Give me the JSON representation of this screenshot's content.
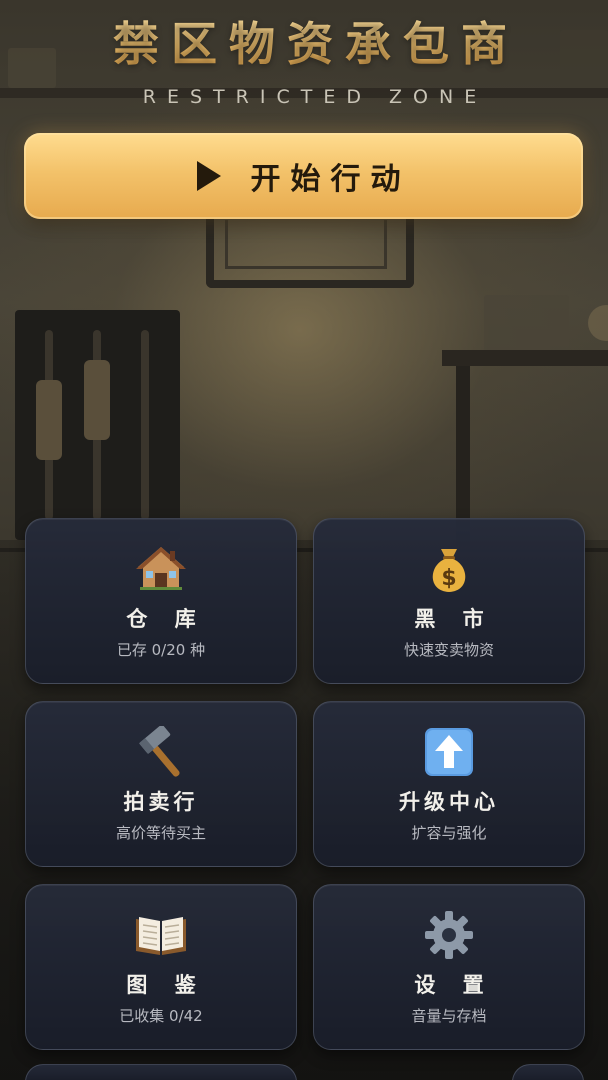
{
  "header": {
    "title": "禁区物资承包商",
    "subtitle": "RESTRICTED ZONE"
  },
  "start_button": {
    "label": "开始行动",
    "icon": "play-icon"
  },
  "menu": [
    {
      "key": "warehouse",
      "icon": "house-icon",
      "label": "仓 库",
      "sub": "已存 0/20 种"
    },
    {
      "key": "black-market",
      "icon": "money-bag-icon",
      "label": "黑 市",
      "sub": "快速变卖物资"
    },
    {
      "key": "auction",
      "icon": "hammer-icon",
      "label": "拍卖行",
      "sub": "高价等待买主"
    },
    {
      "key": "upgrade",
      "icon": "up-arrow-icon",
      "label": "升级中心",
      "sub": "扩容与强化"
    },
    {
      "key": "codex",
      "icon": "book-icon",
      "label": "图 鉴",
      "sub": "已收集 0/42"
    },
    {
      "key": "settings",
      "icon": "gear-icon",
      "label": "设 置",
      "sub": "音量与存档"
    }
  ],
  "colors": {
    "accent_gold": "#f3c26a",
    "title_gold": "#f0c878",
    "card_bg": "#232838"
  }
}
